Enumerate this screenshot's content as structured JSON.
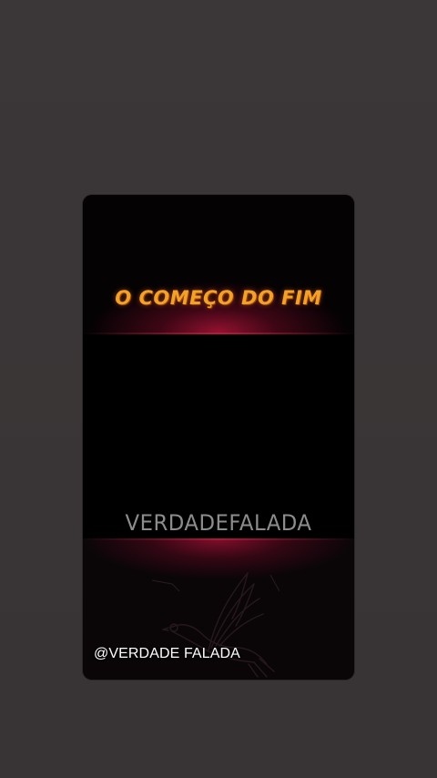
{
  "video": {
    "title": "O COMEÇO DO FIM",
    "watermark": "VERDADEFALADA",
    "handle": "@VERDADE FALADA",
    "bottom_icon": "dove-icon"
  },
  "colors": {
    "background": "#3a3637",
    "title": "#f2a12a",
    "glow": "#aa1437",
    "watermark": "#8c8c8c",
    "handle": "#ffffff"
  }
}
